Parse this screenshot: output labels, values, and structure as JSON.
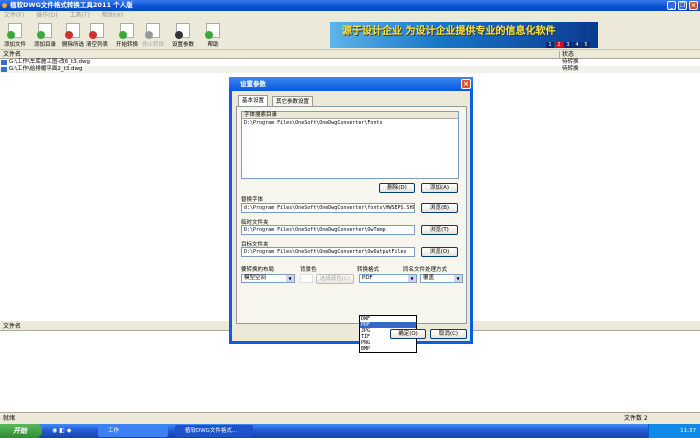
{
  "window": {
    "title": "植软DWG文件格式转换工具2011 个人版"
  },
  "menu": [
    "文件(F)",
    "操作(O)",
    "工具(T)",
    "帮助(H)"
  ],
  "toolbar": [
    {
      "label": "添加文件",
      "icon": "add-file-icon",
      "color": "#3aa83a",
      "enabled": true
    },
    {
      "label": "添加目录",
      "icon": "add-folder-icon",
      "color": "#3aa83a",
      "enabled": true
    },
    {
      "label": "删除所选",
      "icon": "delete-selected-icon",
      "color": "#d03030",
      "enabled": true
    },
    {
      "label": "清空列表",
      "icon": "clear-list-icon",
      "color": "#d03030",
      "enabled": true
    },
    {
      "label": "开始转换",
      "icon": "start-convert-icon",
      "color": "#3aa83a",
      "enabled": true
    },
    {
      "label": "停止转换",
      "icon": "stop-convert-icon",
      "color": "#999999",
      "enabled": false
    },
    {
      "label": "设置参数",
      "icon": "settings-icon",
      "color": "#333333",
      "enabled": true
    },
    {
      "label": "帮助",
      "icon": "help-icon",
      "color": "#3aa83a",
      "enabled": true
    }
  ],
  "banner": {
    "text": "源于设计企业  为设计企业提供专业的信息化软件",
    "pages": [
      "1",
      "2",
      "3",
      "4",
      "5"
    ],
    "active_page": "2"
  },
  "file_list": {
    "columns": [
      "文件名",
      "状态"
    ],
    "rows": [
      {
        "name": "G:\\工作\\车库施工图-改6_t3.dwg",
        "status": "待转换"
      },
      {
        "name": "G:\\工作\\给排暖平面2_t3.dwg",
        "status": "待转换"
      }
    ]
  },
  "lower_panel": {
    "header": "文件名"
  },
  "statusbar": {
    "left": "就绪",
    "right": "文件数 2"
  },
  "taskbar": {
    "start": "开始",
    "tasks": [
      "工作",
      "植软DWG文件格式..."
    ],
    "clock": "11:37"
  },
  "dialog": {
    "title": "设置参数",
    "tabs": [
      "基本设置",
      "其它参数设置"
    ],
    "font_dir": {
      "header": "字体搜索目录",
      "items": [
        "D:\\Program Files\\OneSoft\\OneDwgConverter\\Fonts"
      ],
      "delete": "删除(D)",
      "add": "添加(A)"
    },
    "replace_font": {
      "label": "替换字体",
      "value": "d:\\Program Files\\OneSoft\\OneDwgConverter\\fonts\\HWSEPS.SHX",
      "browse": "浏览(B)"
    },
    "temp_dir": {
      "label": "临时文件夹",
      "value": "D:\\Program Files\\OneSoft\\OneDwgConverter\\OwTemp",
      "browse": "浏览(T)"
    },
    "target_dir": {
      "label": "目标文件夹",
      "value": "D:\\Program Files\\OneSoft\\OneDwgConverter\\OwOutputFiles",
      "browse": "浏览(O)"
    },
    "layout": {
      "label": "要转换的布局",
      "value": "模型空间"
    },
    "bgcolor": {
      "label": "背景色",
      "button": "选择颜色(C)"
    },
    "format": {
      "label": "转换格式",
      "value": "PDF",
      "options": [
        "DWF",
        "PDF",
        "JPG",
        "TIF",
        "PNG",
        "BMP"
      ],
      "selected": "PDF"
    },
    "same_name": {
      "label": "同名文件处理方式",
      "value": "覆盖"
    },
    "ok": "确定(O)",
    "cancel": "取消(C)"
  }
}
